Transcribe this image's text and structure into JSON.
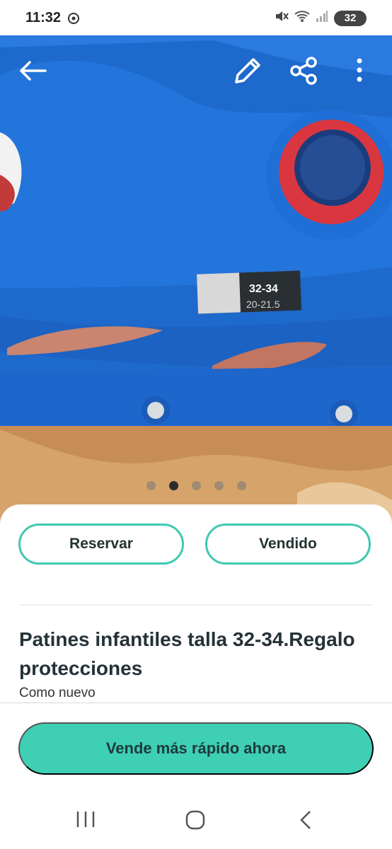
{
  "status_bar": {
    "time": "11:32",
    "battery": "32",
    "icons": [
      "chrome-icon",
      "mute-icon",
      "wifi-icon",
      "signal-icon",
      "battery-icon"
    ]
  },
  "photo": {
    "description_icons": [
      "back-arrow-icon",
      "edit-pencil-icon",
      "share-icon",
      "more-vert-icon"
    ],
    "label_size_top": "32-34",
    "label_size_bottom": "20-21.5",
    "page_indicator": {
      "count": 5,
      "active_index": 1
    }
  },
  "actions": {
    "reserve_label": "Reservar",
    "sold_label": "Vendido"
  },
  "item": {
    "title": "Patines infantiles talla 32-34.Regalo protecciones",
    "condition": "Como nuevo"
  },
  "promote": {
    "label": "Vende más rápido ahora"
  },
  "colors": {
    "accent": "#3ecfb5",
    "outline": "#3ec9b0",
    "text_dark": "#253238"
  },
  "nav_icons": [
    "recent-apps-icon",
    "home-icon",
    "back-icon"
  ]
}
